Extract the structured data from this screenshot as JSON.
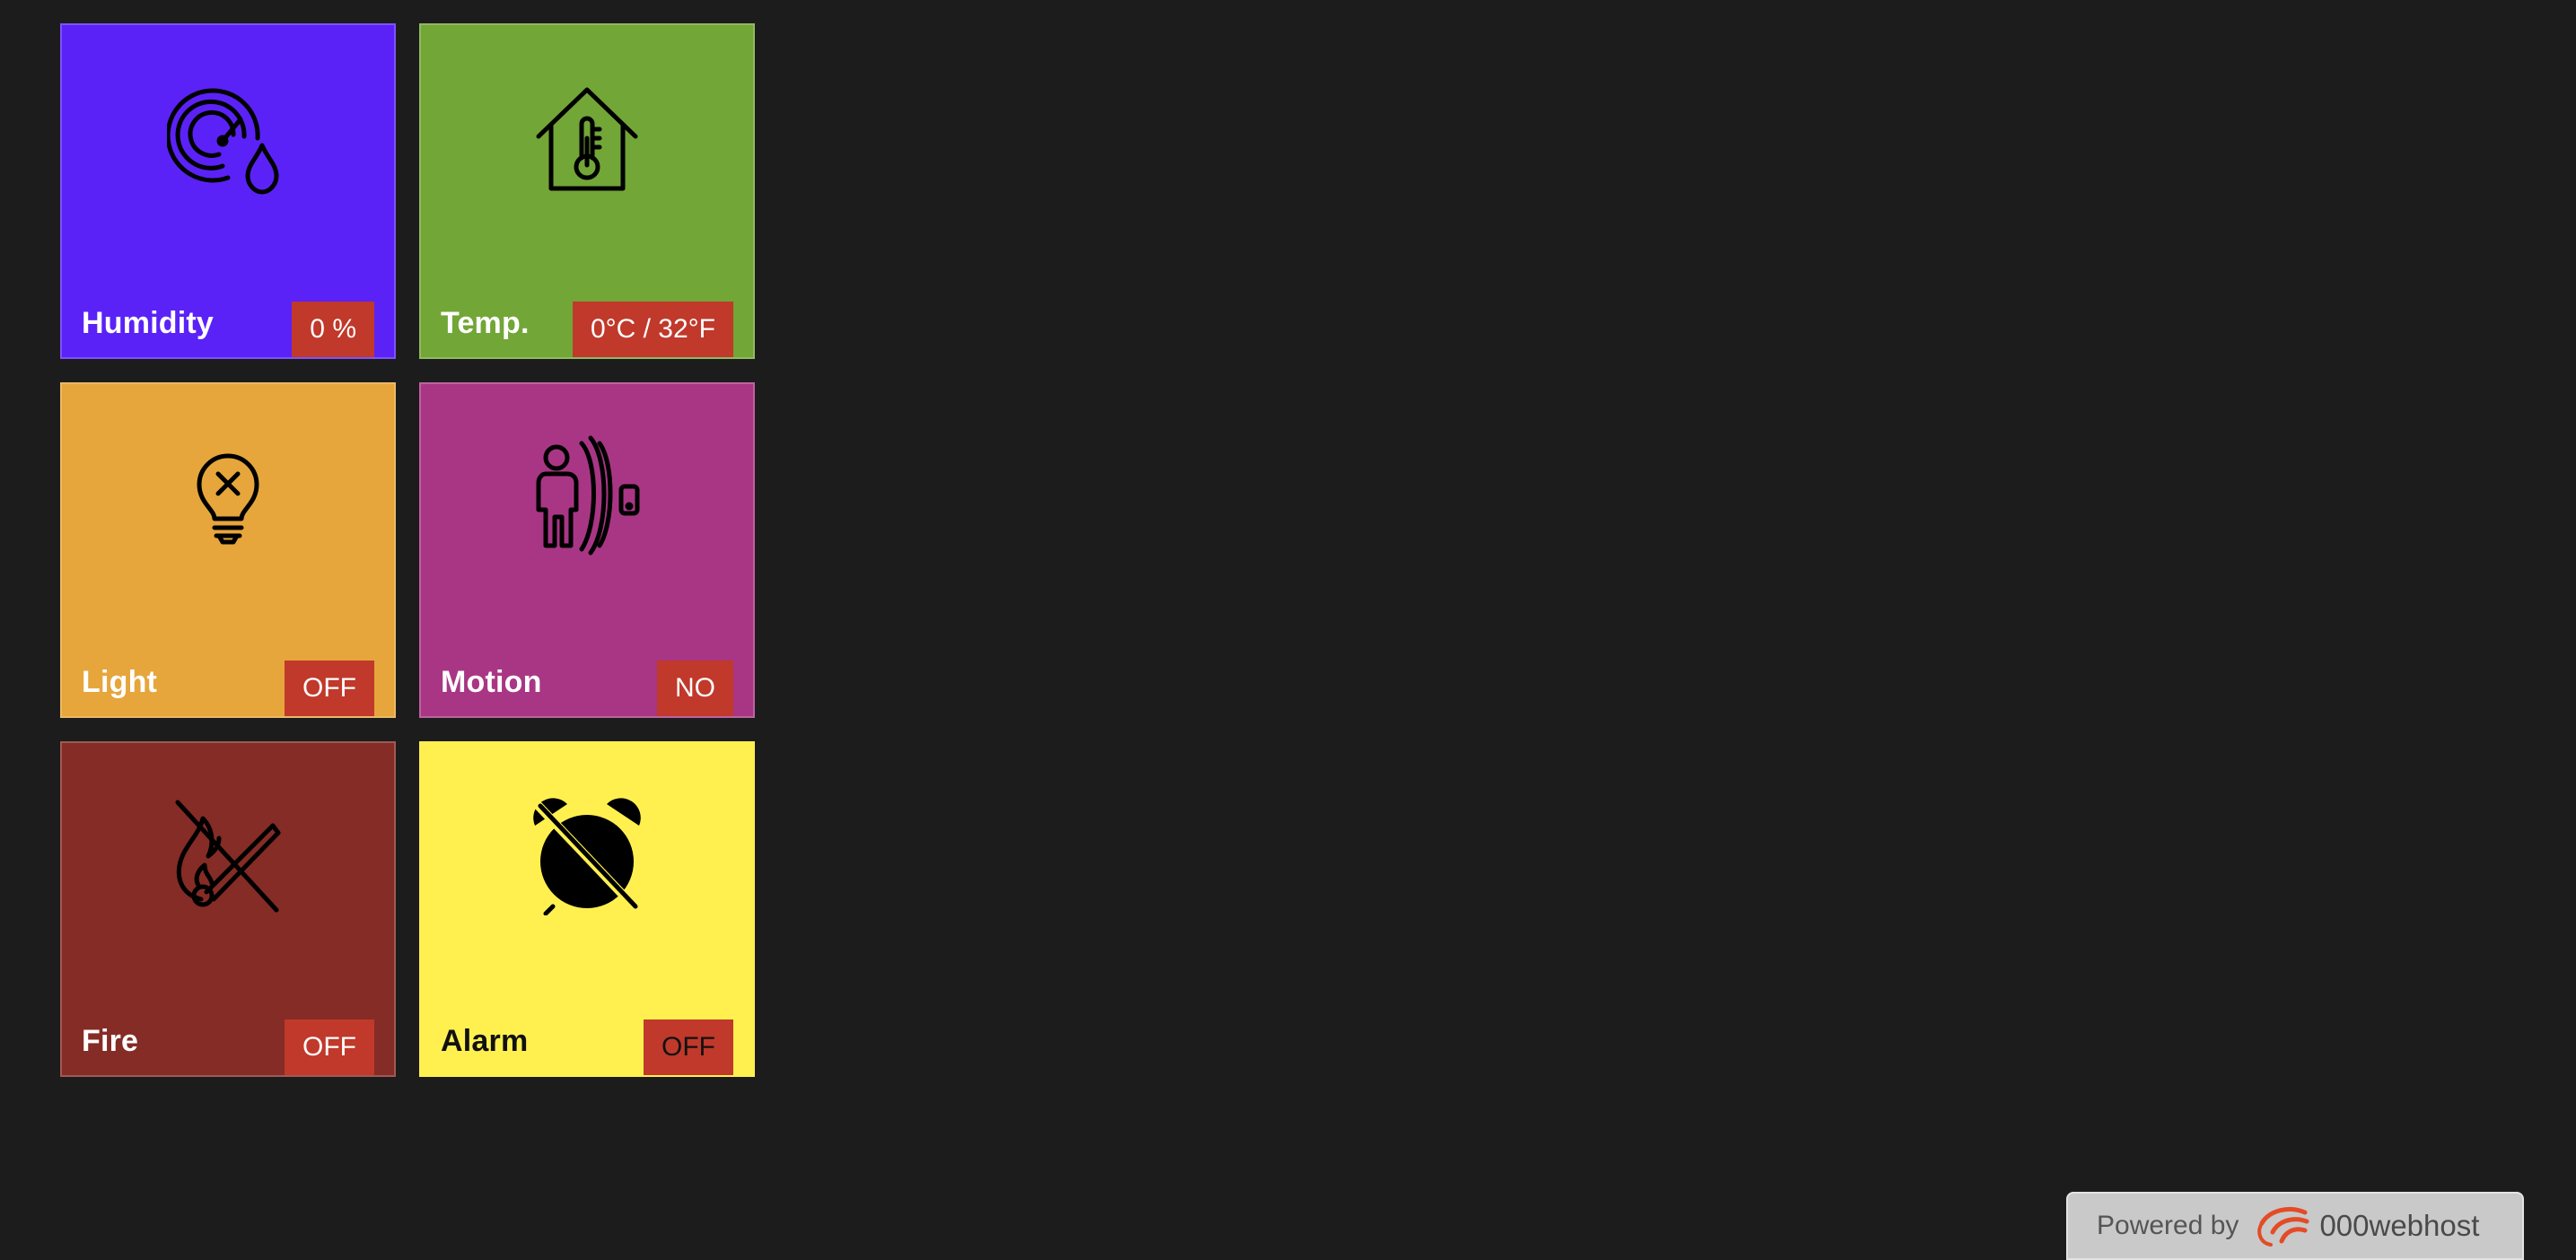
{
  "tiles": [
    {
      "id": "humidity",
      "label": "Humidity",
      "value": "0 %",
      "bg": "#5b22f7",
      "badge": "#c0392b",
      "icon": "humidity-gauge-icon"
    },
    {
      "id": "temp",
      "label": "Temp.",
      "value": "0°C / 32°F",
      "bg": "#72a637",
      "badge": "#c0392b",
      "icon": "house-thermometer-icon"
    },
    {
      "id": "light",
      "label": "Light",
      "value": "OFF",
      "bg": "#e6a63c",
      "badge": "#c0392b",
      "icon": "lightbulb-off-icon"
    },
    {
      "id": "motion",
      "label": "Motion",
      "value": "NO",
      "bg": "#a93685",
      "badge": "#c0392b",
      "icon": "motion-sensor-icon"
    },
    {
      "id": "fire",
      "label": "Fire",
      "value": "OFF",
      "bg": "#842c25",
      "badge": "#c0392b",
      "icon": "fire-off-icon"
    },
    {
      "id": "alarm",
      "label": "Alarm",
      "value": "OFF",
      "bg": "#fff050",
      "badge": "#c0392b",
      "icon": "alarm-off-icon"
    }
  ],
  "footer": {
    "powered_by": "Powered by",
    "brand": "000webhost",
    "brand_color": "#e34c26"
  }
}
